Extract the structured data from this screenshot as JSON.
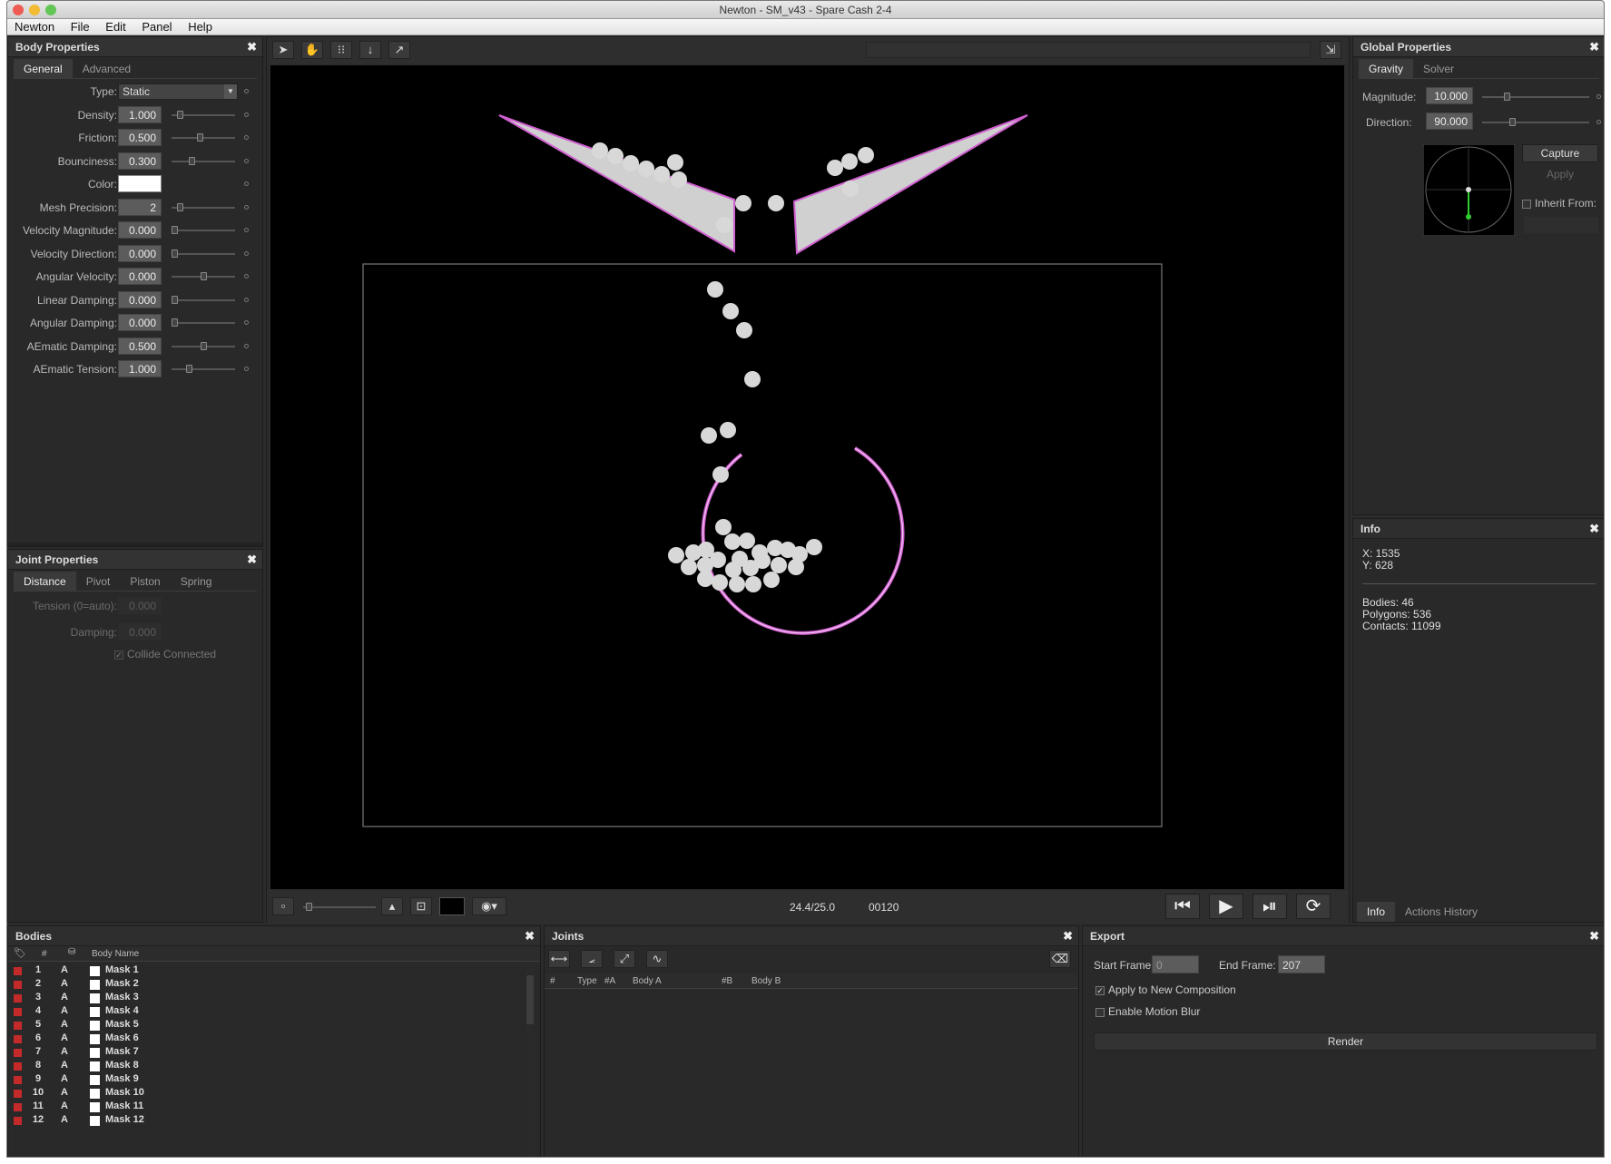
{
  "window": {
    "title": "Newton - SM_v43 - Spare Cash 2-4"
  },
  "menu": [
    "Newton",
    "File",
    "Edit",
    "Panel",
    "Help"
  ],
  "body_properties": {
    "title": "Body Properties",
    "tabs": [
      "General",
      "Advanced"
    ],
    "type_label": "Type:",
    "type_value": "Static",
    "rows": [
      {
        "label": "Density:",
        "value": "1.000",
        "level": 0.1
      },
      {
        "label": "Friction:",
        "value": "0.500",
        "level": 0.45
      },
      {
        "label": "Bounciness:",
        "value": "0.300",
        "level": 0.3
      },
      {
        "label": "Color:",
        "value": "",
        "level": null
      },
      {
        "label": "Mesh Precision:",
        "value": "2",
        "level": 0.1
      },
      {
        "label": "Velocity Magnitude:",
        "value": "0.000",
        "level": 0
      },
      {
        "label": "Velocity Direction:",
        "value": "0.000",
        "level": 0
      },
      {
        "label": "Angular Velocity:",
        "value": "0.000",
        "level": 0.5
      },
      {
        "label": "Linear Damping:",
        "value": "0.000",
        "level": 0
      },
      {
        "label": "Angular Damping:",
        "value": "0.000",
        "level": 0
      },
      {
        "label": "AEmatic Damping:",
        "value": "0.500",
        "level": 0.5
      },
      {
        "label": "AEmatic Tension:",
        "value": "1.000",
        "level": 0.25
      }
    ]
  },
  "joint_properties": {
    "title": "Joint Properties",
    "tabs": [
      "Distance",
      "Pivot",
      "Piston",
      "Spring"
    ],
    "tension_label": "Tension (0=auto):",
    "tension_value": "0.000",
    "damping_label": "Damping:",
    "damping_value": "0.000",
    "collide_label": "Collide Connected"
  },
  "viewport": {
    "fps": "24.4/25.0",
    "frame": "00120"
  },
  "global_properties": {
    "title": "Global Properties",
    "tabs": [
      "Gravity",
      "Solver"
    ],
    "magnitude_label": "Magnitude:",
    "magnitude_value": "10.000",
    "direction_label": "Direction:",
    "direction_value": "90.000",
    "capture_label": "Capture",
    "apply_label": "Apply",
    "inherit_label": "Inherit From:"
  },
  "info": {
    "title": "Info",
    "x": "X: 1535",
    "y": "Y: 628",
    "bodies": "Bodies: 46",
    "polygons": "Polygons: 536",
    "contacts": "Contacts: 11099",
    "tabs": [
      "Info",
      "Actions History"
    ]
  },
  "bodies": {
    "title": "Bodies",
    "col_num": "#",
    "col_name": "Body Name",
    "rows": [
      {
        "n": "1",
        "a": "A",
        "name": "Mask 1"
      },
      {
        "n": "2",
        "a": "A",
        "name": "Mask 2"
      },
      {
        "n": "3",
        "a": "A",
        "name": "Mask 3"
      },
      {
        "n": "4",
        "a": "A",
        "name": "Mask 4"
      },
      {
        "n": "5",
        "a": "A",
        "name": "Mask 5"
      },
      {
        "n": "6",
        "a": "A",
        "name": "Mask 6"
      },
      {
        "n": "7",
        "a": "A",
        "name": "Mask 7"
      },
      {
        "n": "8",
        "a": "A",
        "name": "Mask 8"
      },
      {
        "n": "9",
        "a": "A",
        "name": "Mask 9"
      },
      {
        "n": "10",
        "a": "A",
        "name": "Mask 10"
      },
      {
        "n": "11",
        "a": "A",
        "name": "Mask 11"
      },
      {
        "n": "12",
        "a": "A",
        "name": "Mask 12"
      }
    ]
  },
  "joints": {
    "title": "Joints",
    "cols": {
      "num": "#",
      "type": "Type",
      "a": "#A",
      "body_a": "Body A",
      "b": "#B",
      "body_b": "Body B"
    }
  },
  "export": {
    "title": "Export",
    "start_label": "Start Frame:",
    "start_value": "0",
    "end_label": "End Frame:",
    "end_value": "207",
    "apply_new_label": "Apply to New Composition",
    "motion_blur_label": "Enable Motion Blur",
    "render_label": "Render"
  },
  "colors": {
    "accent": "#d060d0",
    "panel": "#292929",
    "ball": "#d8d8d8"
  }
}
